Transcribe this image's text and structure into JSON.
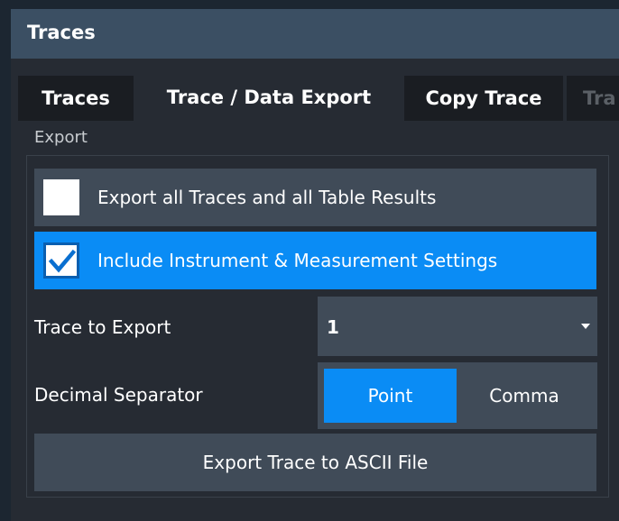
{
  "window": {
    "title": "Traces"
  },
  "tabs": [
    {
      "label": "Traces"
    },
    {
      "label": "Trace / Data Export"
    },
    {
      "label": "Copy Trace"
    },
    {
      "label": "Tra"
    }
  ],
  "export_section": {
    "label": "Export",
    "export_all": {
      "label": "Export all Traces and all Table Results",
      "checked": false
    },
    "include_settings": {
      "label": "Include Instrument & Measurement Settings",
      "checked": true
    },
    "trace_to_export": {
      "label": "Trace to Export",
      "value": "1"
    },
    "decimal_separator": {
      "label": "Decimal Separator",
      "options": [
        "Point",
        "Comma"
      ],
      "selected": "Point"
    },
    "export_button": {
      "label": "Export Trace to ASCII File"
    }
  },
  "colors": {
    "accent": "#0a8cf5",
    "title_bar": "#3b4f63",
    "button": "#404b58"
  },
  "icons": {
    "checkmark": "checkmark-icon",
    "dropdown": "chevron-down-icon"
  }
}
